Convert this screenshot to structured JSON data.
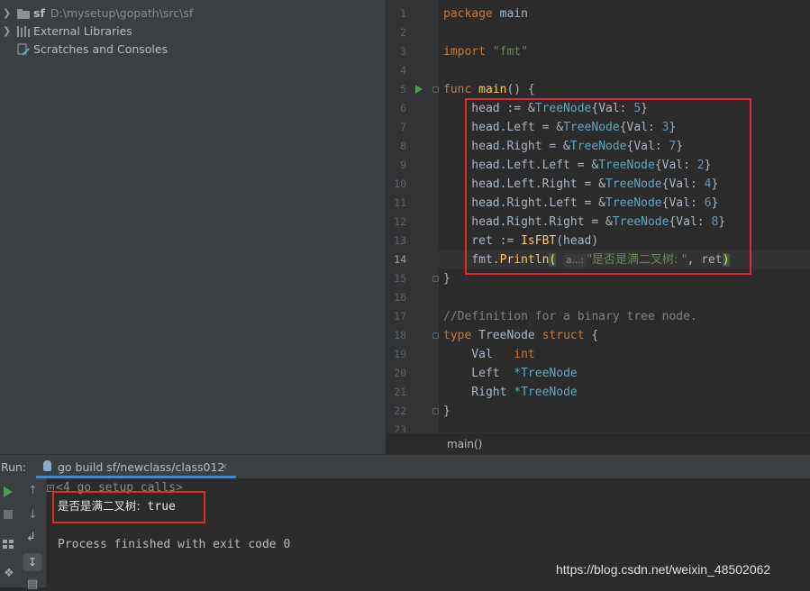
{
  "project_tree": {
    "items": [
      {
        "name": "sf",
        "path": "D:\\mysetup\\gopath\\src\\sf"
      },
      {
        "name": "External Libraries"
      },
      {
        "name": "Scratches and Consoles"
      }
    ]
  },
  "editor": {
    "line_numbers": [
      "1",
      "2",
      "3",
      "4",
      "5",
      "6",
      "7",
      "8",
      "9",
      "10",
      "11",
      "12",
      "13",
      "14",
      "15",
      "16",
      "17",
      "18",
      "19",
      "20",
      "21",
      "22",
      "23"
    ],
    "current_line": "14",
    "code": {
      "l1_kw": "package",
      "l1_rest": " main",
      "l3_kw": "import",
      "l3_str": " \"fmt\"",
      "l5_kw": "func",
      "l5_fn": " main",
      "l5_rest": "() {",
      "l6": [
        "    head := &",
        "TreeNode",
        "{Val: ",
        "5",
        "}"
      ],
      "l7": [
        "    head.Left = &",
        "TreeNode",
        "{Val: ",
        "3",
        "}"
      ],
      "l8": [
        "    head.Right = &",
        "TreeNode",
        "{Val: ",
        "7",
        "}"
      ],
      "l9": [
        "    head.Left.Left = &",
        "TreeNode",
        "{Val: ",
        "2",
        "}"
      ],
      "l10": [
        "    head.Left.Right = &",
        "TreeNode",
        "{Val: ",
        "4",
        "}"
      ],
      "l11": [
        "    head.Right.Left = &",
        "TreeNode",
        "{Val: ",
        "6",
        "}"
      ],
      "l12": [
        "    head.Right.Right = &",
        "TreeNode",
        "{Val: ",
        "8",
        "}"
      ],
      "l13_pre": "    ret := ",
      "l13_fn": "IsFBT",
      "l13_post": "(head)",
      "l14_pre": "    fmt.",
      "l14_fn": "Println",
      "l14_open": "(",
      "l14_hint": "a...:",
      "l14_str": "\"是否是满二叉树: \"",
      "l14_post": ", ret",
      "l14_close": ")",
      "l15": "}",
      "l17": "//Definition for a binary tree node.",
      "l18_kw": "type",
      "l18_rest": " TreeNode ",
      "l18_kw2": "struct",
      "l18_end": " {",
      "l19_field": "    Val   ",
      "l19_type": "int",
      "l20_field": "    Left  ",
      "l20_type": "*TreeNode",
      "l21_field": "    Right ",
      "l21_type": "*TreeNode",
      "l22": "}"
    },
    "breadcrumb": "main()"
  },
  "run_panel": {
    "label": "Run:",
    "tab_label": "go build sf/newclass/class012",
    "tab_close": "×",
    "collapsed_calls": "<4 go setup calls>",
    "output_label": "是否是满二叉树:",
    "output_value": " true",
    "process_message": "Process finished with exit code 0"
  },
  "watermark": "https://blog.csdn.net/weixin_48502062",
  "colors": {
    "keyword": "#cc7832",
    "string": "#6a8759",
    "number": "#6897bb",
    "type": "#5fa8c0",
    "function": "#ffc66d",
    "comment": "#808080",
    "highlight_box": "#e12b2b",
    "run_green": "#499c54",
    "tab_underline": "#4a88c7"
  }
}
